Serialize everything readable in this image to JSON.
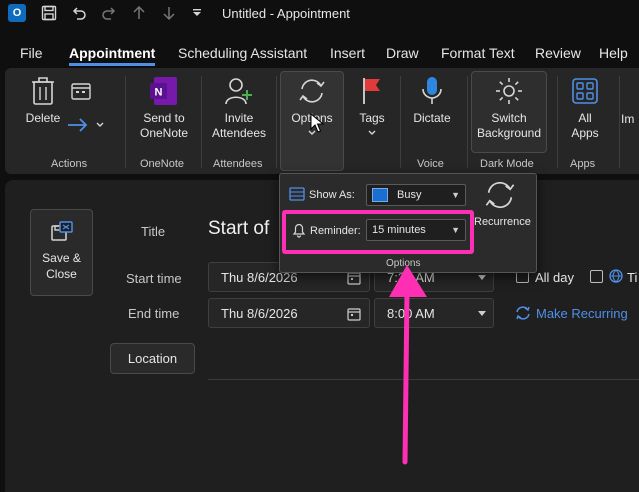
{
  "titlebar": {
    "app_icon": "O",
    "title": "Untitled  -  Appointment"
  },
  "menu": {
    "tabs": [
      "File",
      "Appointment",
      "Scheduling Assistant",
      "Insert",
      "Draw",
      "Format Text",
      "Review",
      "Help"
    ],
    "active": "Appointment"
  },
  "ribbon": {
    "delete_label": "Delete",
    "actions_group": "Actions",
    "send_onenote_label": "Send to\nOneNote",
    "onenote_group": "OneNote",
    "invite_label": "Invite\nAttendees",
    "attendees_group": "Attendees",
    "options_label": "Options",
    "tags_label": "Tags",
    "dictate_label": "Dictate",
    "voice_group": "Voice",
    "switch_bg_label": "Switch\nBackground",
    "darkmode_group": "Dark Mode",
    "all_apps_label": "All\nApps",
    "apps_group": "Apps",
    "truncated_label": "Im"
  },
  "options_popup": {
    "show_as_label": "Show As:",
    "show_as_value": "Busy",
    "reminder_label": "Reminder:",
    "reminder_value": "15 minutes",
    "recurrence_label": "Recurrence",
    "group_label": "Options"
  },
  "form": {
    "save_close_label": "Save &\nClose",
    "title_label": "Title",
    "title_value": "Start of",
    "start_time_label": "Start time",
    "start_date": "Thu 8/6/2026",
    "start_time_value": "7:30 AM",
    "end_time_label": "End time",
    "end_date": "Thu 8/6/2026",
    "end_time_value": "8:00 AM",
    "all_day_label": "All day",
    "make_recurring_label": "Make Recurring",
    "location_label": "Location",
    "time_zone_truncated": "Ti"
  },
  "colors": {
    "accent": "#4f8fe8",
    "highlight": "#ff2fb4",
    "busy": "#1a6fd1"
  }
}
